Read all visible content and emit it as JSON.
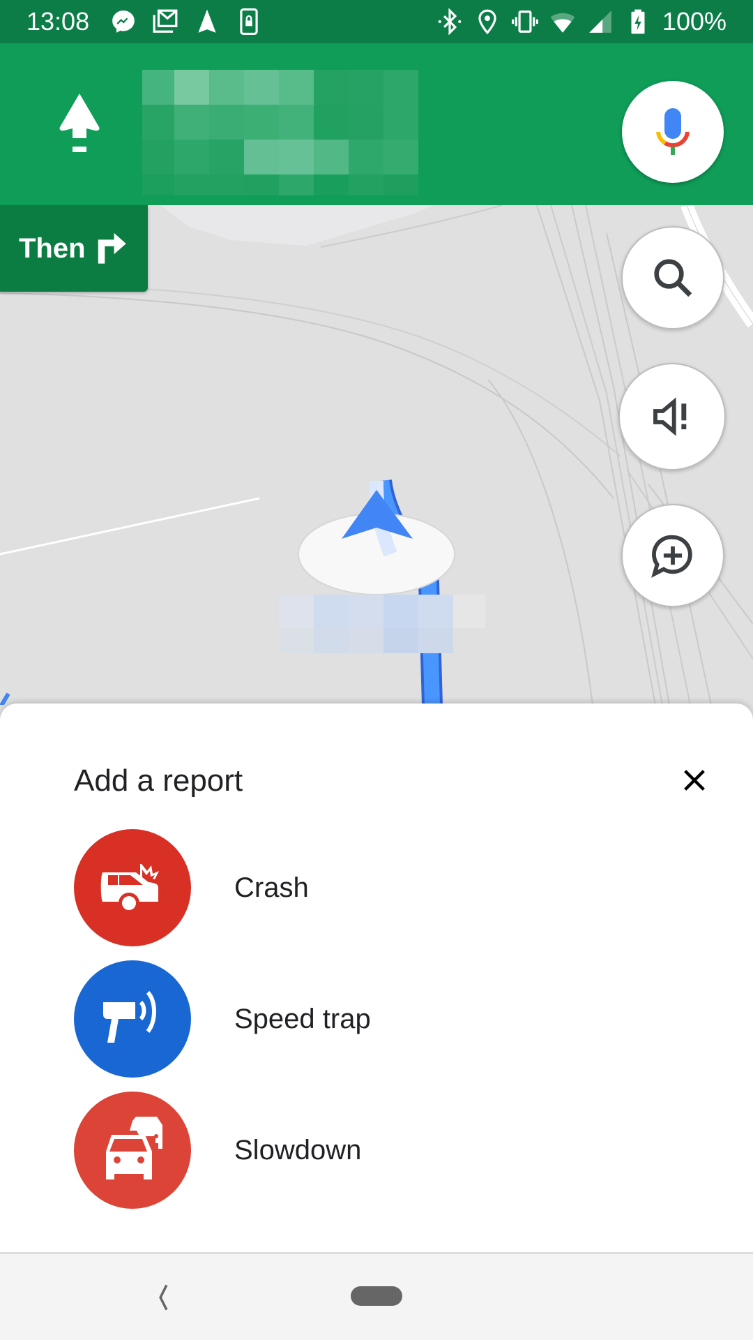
{
  "status_bar": {
    "time": "13:08",
    "battery_percent": "100%",
    "left_icons": [
      "messenger-icon",
      "gmail-icon",
      "navigation-icon",
      "screen-lock-icon"
    ],
    "right_icons": [
      "bluetooth-icon",
      "location-icon",
      "vibrate-icon",
      "wifi-icon",
      "cell-signal-icon",
      "battery-charging-icon"
    ]
  },
  "navigation": {
    "maneuver_icon": "straight-arrow-icon",
    "street_name_obscured": true,
    "then_label": "Then",
    "then_icon": "turn-right-icon"
  },
  "map_controls": {
    "voice_icon": "microphone-icon",
    "search_icon": "search-icon",
    "mute_icon": "volume-alert-icon",
    "report_icon": "add-report-icon"
  },
  "report_sheet": {
    "title": "Add a report",
    "close_icon": "close-icon",
    "items": [
      {
        "label": "Crash",
        "icon": "crash-icon",
        "color": "#d93025"
      },
      {
        "label": "Speed trap",
        "icon": "speed-trap-icon",
        "color": "#1967d2"
      },
      {
        "label": "Slowdown",
        "icon": "slowdown-icon",
        "color": "#db4437"
      }
    ]
  },
  "colors": {
    "status_bar": "#0d7d48",
    "nav_header": "#0f9d58",
    "then_chip": "#0b7d43",
    "route_blue": "#4285f4",
    "map_bg": "#e0e0e0"
  },
  "system_nav": {
    "back_icon": "back-chevron-icon",
    "home_icon": "home-pill-icon"
  }
}
